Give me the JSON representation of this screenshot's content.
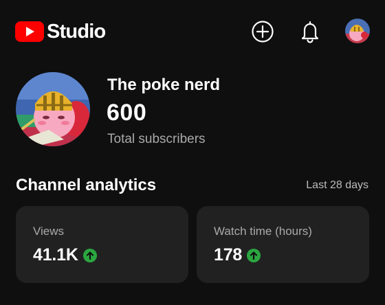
{
  "header": {
    "logo_text": "Studio",
    "brand_color": "#ff0000",
    "icons": [
      "youtube-logo-icon",
      "create-plus-icon",
      "bell-icon",
      "profile-avatar"
    ]
  },
  "channel": {
    "name": "The poke nerd",
    "subscriber_count": "600",
    "subscriber_label": "Total subscribers"
  },
  "analytics": {
    "title": "Channel analytics",
    "period": "Last 28 days",
    "trend_color": "#2ba640",
    "cards": [
      {
        "label": "Views",
        "value": "41.1K",
        "trend": "up"
      },
      {
        "label": "Watch time (hours)",
        "value": "178",
        "trend": "up"
      }
    ]
  }
}
